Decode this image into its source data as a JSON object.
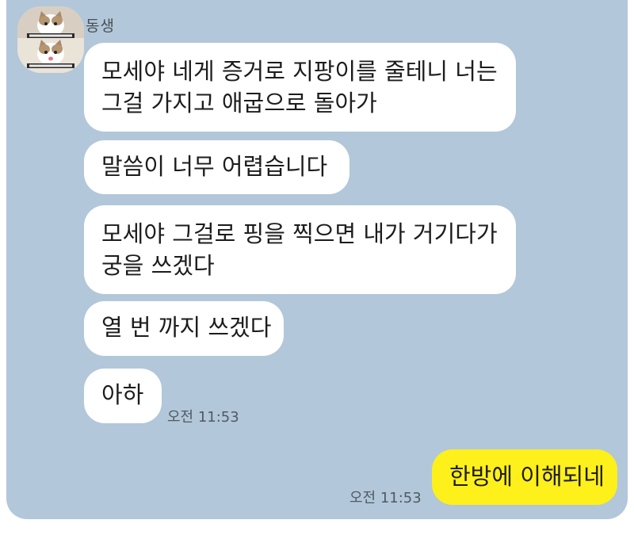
{
  "chat": {
    "sender_name": "동생",
    "avatar_icon": "cat-photo-avatar",
    "messages": [
      {
        "lines": [
          "모세야 네게 증거로 지팡이를 줄테니 너는",
          "그걸 가지고 애굽으로 돌아가"
        ]
      },
      {
        "lines": [
          "말씀이 너무 어렵습니다"
        ]
      },
      {
        "lines": [
          "모세야 그걸로 핑을 찍으면 내가 거기다가",
          "궁을 쓰겠다"
        ]
      },
      {
        "lines": [
          "열 번 까지 쓰겠다"
        ]
      },
      {
        "lines": [
          "아하"
        ],
        "time": "오전 11:53"
      }
    ],
    "my_message": {
      "text": "한방에 이해되네",
      "time": "오전 11:53"
    }
  },
  "colors": {
    "background": "#b2c7d9",
    "received_bubble": "#ffffff",
    "sent_bubble": "#fef01b"
  }
}
